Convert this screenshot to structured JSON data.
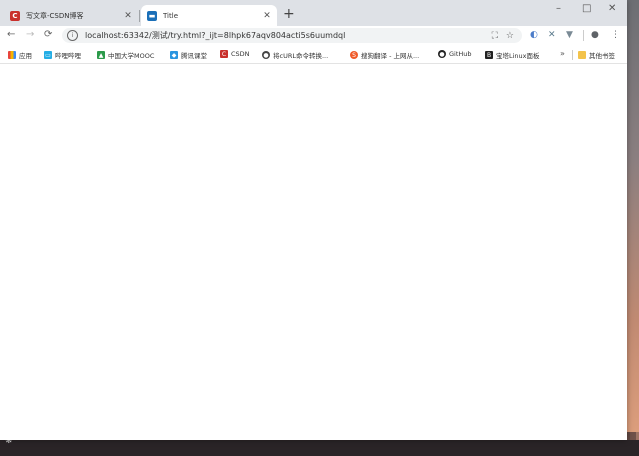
{
  "browser": {
    "tabs": [
      {
        "title": "写文章-CSDN博客",
        "icon": "csdn-icon",
        "active": false
      },
      {
        "title": "Title",
        "icon": "page-icon",
        "active": true
      }
    ],
    "new_tab_label": "+",
    "window_controls": {
      "minimize": "–",
      "maximize": "□",
      "close": "✕"
    },
    "toolbar": {
      "back": "←",
      "forward": "→",
      "reload": "C",
      "address": "localhost:63342/测试/try.html?_ijt=8lhpk67aqv804acti5s6uumdql"
    },
    "bookmarks": [
      {
        "label": "应用",
        "icon": "apps-grid-icon",
        "color": "#e8453c"
      },
      {
        "label": "哔哩哔哩",
        "icon": "bilibili-icon",
        "color": "#23ade5"
      },
      {
        "label": "中国大学MOOC",
        "icon": "mooc-icon",
        "color": "#2b9a4a"
      },
      {
        "label": "腾讯课堂",
        "icon": "tencent-class-icon",
        "color": "#2a95e0"
      },
      {
        "label": "CSDN",
        "icon": "csdn-icon",
        "color": "#c9302c"
      },
      {
        "label": "将cURL命令转换...",
        "icon": "globe-icon",
        "color": "#444444"
      },
      {
        "label": "搜狗翻译 - 上网从...",
        "icon": "sogou-icon",
        "color": "#f05a28"
      },
      {
        "label": "GitHub",
        "icon": "github-icon",
        "color": "#222222"
      },
      {
        "label": "宝塔Linux面板",
        "icon": "bt-icon",
        "color": "#222222"
      }
    ],
    "bookmarks_more": "»",
    "other_bookmarks": "其他书签"
  },
  "desktop": {
    "taskbar_glyph": "❋"
  }
}
